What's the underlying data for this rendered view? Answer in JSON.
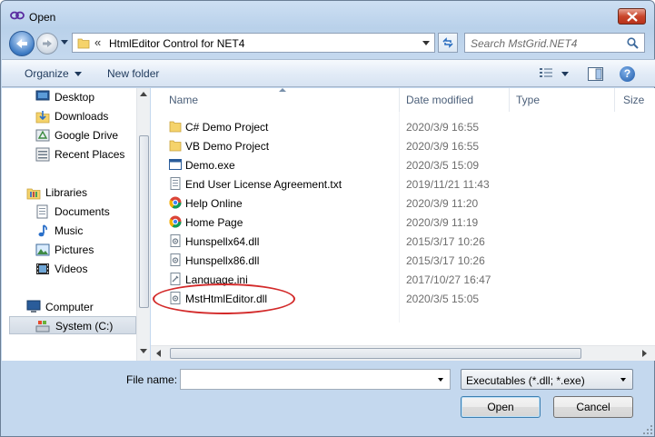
{
  "window": {
    "title": "Open",
    "close_icon": "close-icon"
  },
  "address": {
    "breadcrumb_prefix": "«",
    "path": "HtmlEditor Control for NET4"
  },
  "search": {
    "placeholder": "Search MstGrid.NET4"
  },
  "toolbar": {
    "organize_label": "Organize",
    "new_folder_label": "New folder"
  },
  "sidebar": {
    "items": [
      {
        "label": "Desktop",
        "icon": "desktop-icon"
      },
      {
        "label": "Downloads",
        "icon": "downloads-icon"
      },
      {
        "label": "Google Drive",
        "icon": "google-drive-icon"
      },
      {
        "label": "Recent Places",
        "icon": "recent-places-icon"
      },
      {
        "label": "Libraries",
        "icon": "libraries-icon"
      },
      {
        "label": "Documents",
        "icon": "documents-icon"
      },
      {
        "label": "Music",
        "icon": "music-icon"
      },
      {
        "label": "Pictures",
        "icon": "pictures-icon"
      },
      {
        "label": "Videos",
        "icon": "videos-icon"
      },
      {
        "label": "Computer",
        "icon": "computer-icon"
      },
      {
        "label": "System (C:)",
        "icon": "drive-icon"
      }
    ]
  },
  "columns": {
    "name": "Name",
    "date_modified": "Date modified",
    "type": "Type",
    "size": "Size"
  },
  "files": [
    {
      "name": "C# Demo Project",
      "date": "2020/3/9 16:55",
      "icon": "folder-icon"
    },
    {
      "name": "VB Demo Project",
      "date": "2020/3/9 16:55",
      "icon": "folder-icon"
    },
    {
      "name": "Demo.exe",
      "date": "2020/3/5 15:09",
      "icon": "exe-icon"
    },
    {
      "name": "End User License Agreement.txt",
      "date": "2019/11/21 11:43",
      "icon": "text-file-icon"
    },
    {
      "name": "Help Online",
      "date": "2020/3/9 11:20",
      "icon": "chrome-shortcut-icon"
    },
    {
      "name": "Home Page",
      "date": "2020/3/9 11:19",
      "icon": "chrome-shortcut-icon"
    },
    {
      "name": "Hunspellx64.dll",
      "date": "2015/3/17 10:26",
      "icon": "dll-icon"
    },
    {
      "name": "Hunspellx86.dll",
      "date": "2015/3/17 10:26",
      "icon": "dll-icon"
    },
    {
      "name": "Language.ini",
      "date": "2017/10/27 16:47",
      "icon": "ini-file-icon"
    },
    {
      "name": "MstHtmlEditor.dll",
      "date": "2020/3/5 15:05",
      "icon": "dll-icon"
    }
  ],
  "bottom": {
    "file_name_label": "File name:",
    "file_name_value": "",
    "file_type": "Executables (*.dll; *.exe)",
    "open_label": "Open",
    "cancel_label": "Cancel"
  },
  "colors": {
    "accent": "#3c7fb1",
    "highlight_oval": "#d32a2a",
    "folder": "#f5d36b"
  }
}
